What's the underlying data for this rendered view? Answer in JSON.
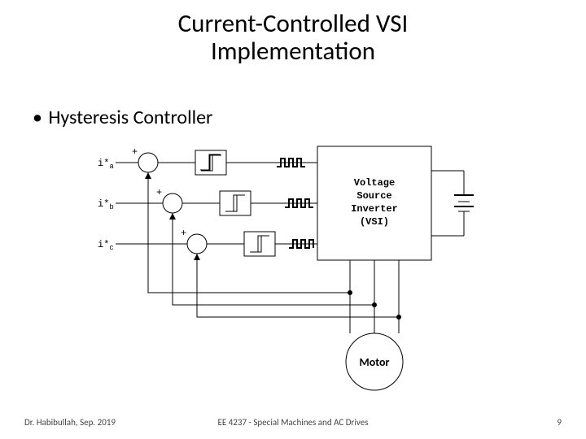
{
  "title_line1": "Current-Controlled VSI",
  "title_line2": "Implementation",
  "bullet_text": "Hysteresis Controller",
  "inputs": {
    "a": {
      "sym": "i*",
      "sub": "a",
      "plus": "+"
    },
    "b": {
      "sym": "i*",
      "sub": "b",
      "plus": "+"
    },
    "c": {
      "sym": "i*",
      "sub": "c",
      "plus": "+"
    }
  },
  "vsi": {
    "l1": "Voltage",
    "l2": "Source",
    "l3": "Inverter",
    "l4": "(VSI)"
  },
  "motor_label": "Motor",
  "footer_left": "Dr. Habibullah, Sep. 2019",
  "footer_center": "EE 4237 - Special Machines and AC Drives",
  "footer_right": "9"
}
